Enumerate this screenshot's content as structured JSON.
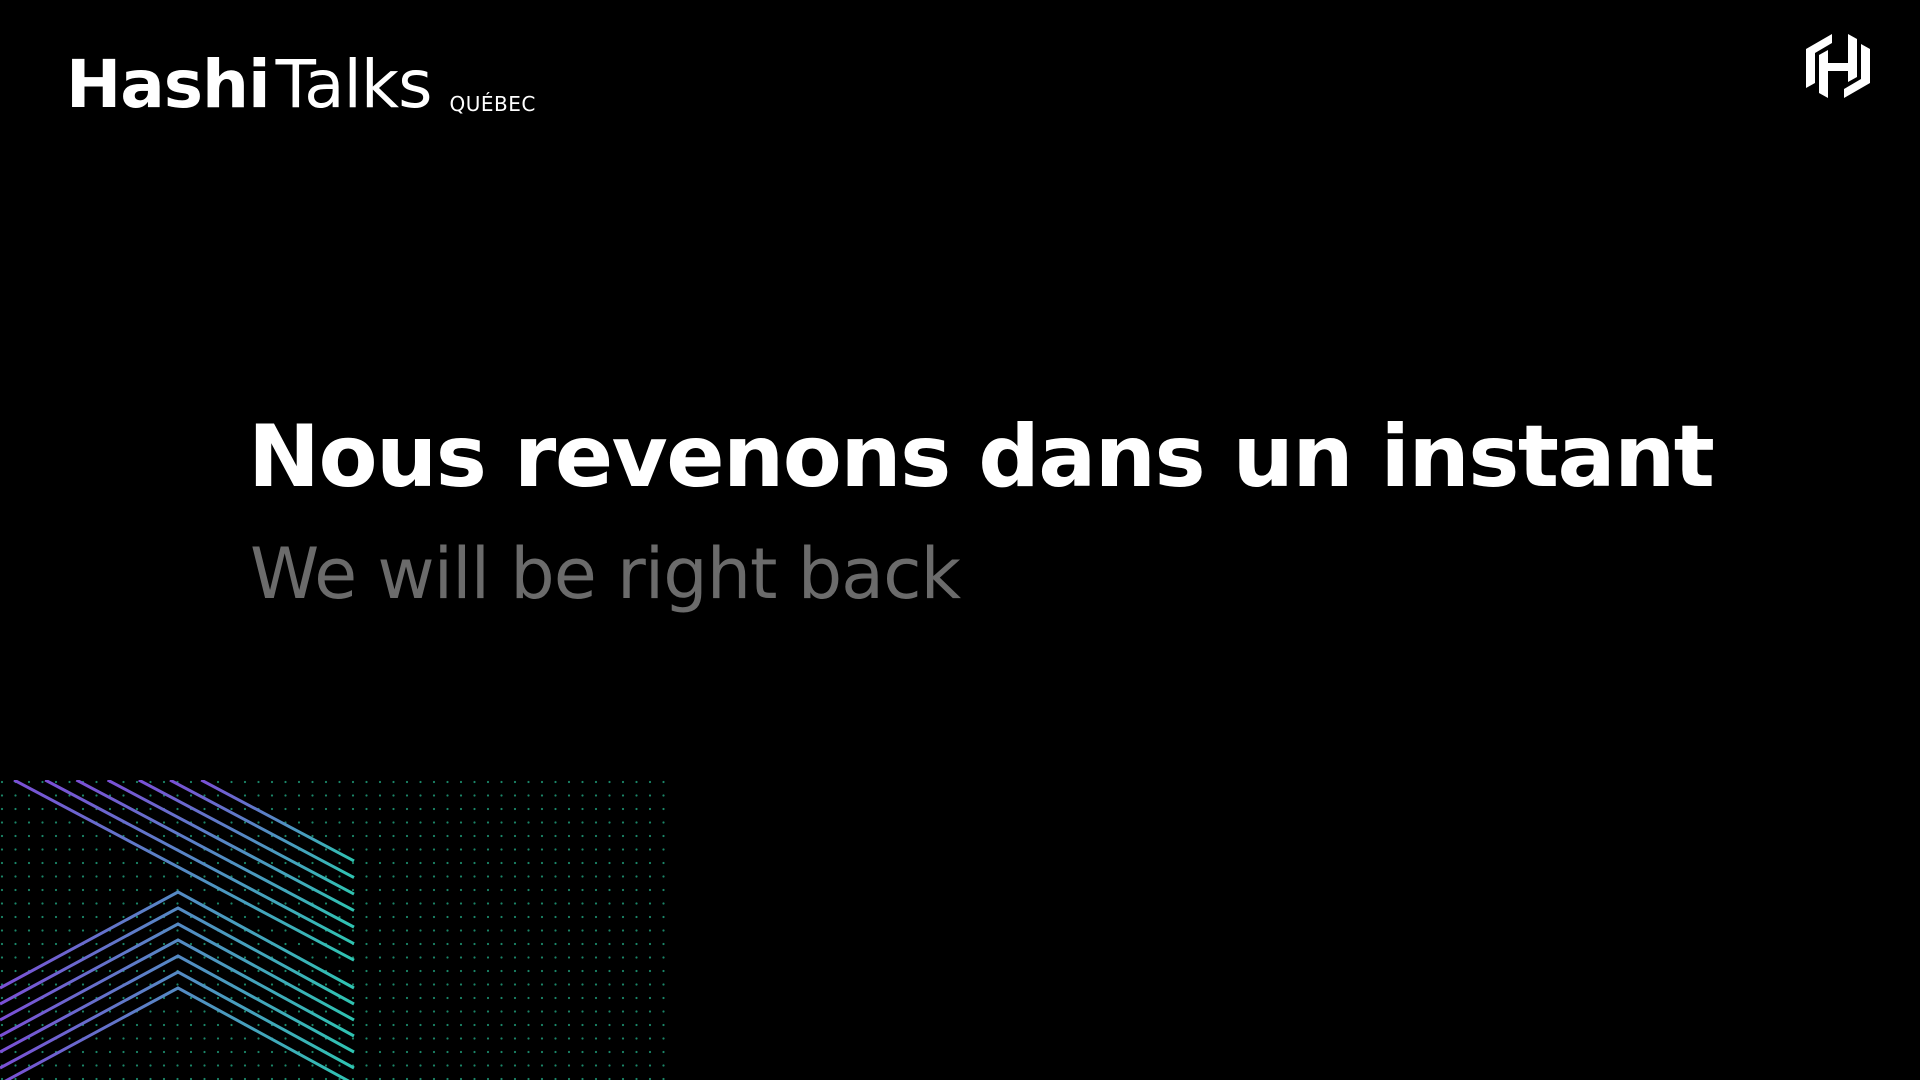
{
  "brand": {
    "name_bold": "Hashi",
    "name_light": "Talks",
    "city": "QUÉBEC"
  },
  "logo": {
    "icon": "hashicorp-logo-icon"
  },
  "message": {
    "headline": "Nous revenons dans un instant",
    "subheadline": "We will be right back"
  },
  "colors": {
    "background": "#000000",
    "headline": "#ffffff",
    "subheadline": "#6b6b6b",
    "stripe_start": "#7b4fd6",
    "stripe_end": "#2fc4b2",
    "dots": "#1f9e7a"
  }
}
